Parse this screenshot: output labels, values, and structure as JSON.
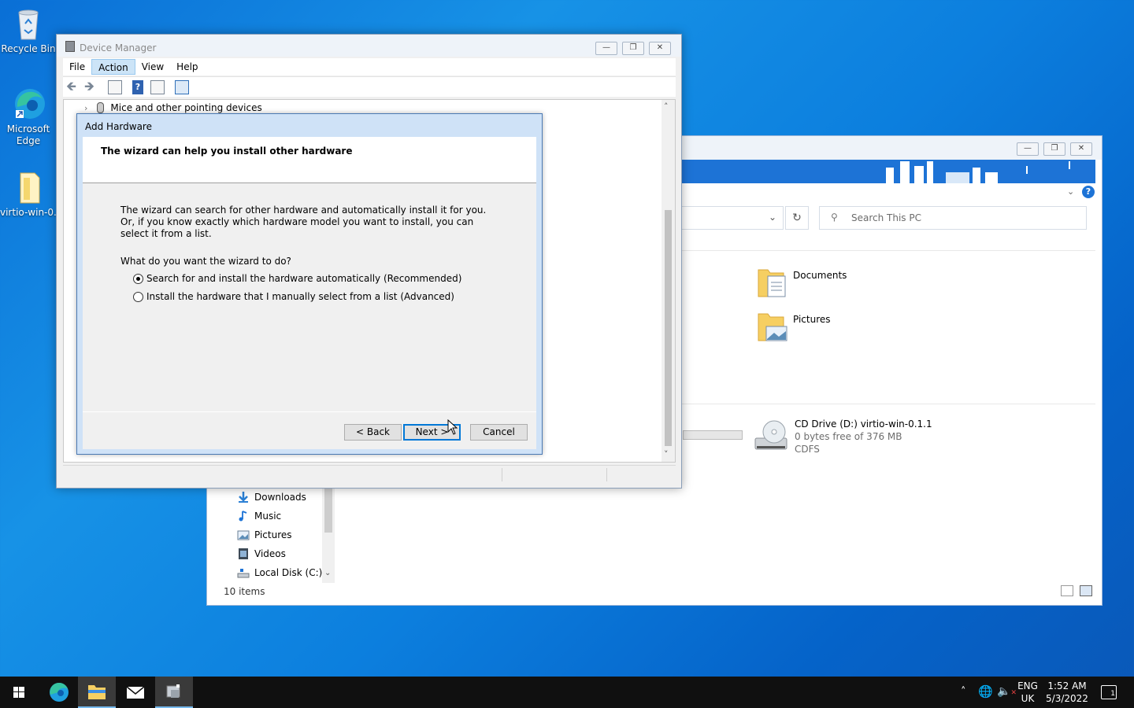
{
  "desktop": {
    "icons": [
      {
        "label": "Recycle Bin"
      },
      {
        "label": "Microsoft Edge"
      },
      {
        "label": "virtio-win-0..."
      }
    ]
  },
  "explorer": {
    "search_placeholder": "Search This PC",
    "folders": [
      {
        "name": "Documents"
      },
      {
        "name": "Pictures"
      }
    ],
    "drive": {
      "name": "CD Drive (D:) virtio-win-0.1.1",
      "free": "0 bytes free of 376 MB",
      "fs": "CDFS"
    },
    "nav": [
      {
        "label": "Downloads"
      },
      {
        "label": "Music"
      },
      {
        "label": "Pictures"
      },
      {
        "label": "Videos"
      },
      {
        "label": "Local Disk (C:)"
      }
    ],
    "status": "10 items"
  },
  "device_manager": {
    "title": "Device Manager",
    "menu": [
      {
        "label": "File"
      },
      {
        "label": "Action"
      },
      {
        "label": "View"
      },
      {
        "label": "Help"
      }
    ],
    "tree_item": "Mice and other pointing devices"
  },
  "wizard": {
    "title": "Add Hardware",
    "header": "The wizard can help you install other hardware",
    "description": "The wizard can search for other hardware and automatically install it for you. Or, if you know exactly which hardware model you want to install, you can select it from a list.",
    "question": "What do you want the wizard to do?",
    "options": [
      {
        "label": "Search for and install the hardware automatically (Recommended)",
        "selected": true
      },
      {
        "label": "Install the hardware that I manually select from a list (Advanced)",
        "selected": false
      }
    ],
    "buttons": {
      "back": "< Back",
      "next": "Next >",
      "cancel": "Cancel"
    }
  },
  "taskbar": {
    "lang_top": "ENG",
    "lang_bottom": "UK",
    "time": "1:52 AM",
    "date": "5/3/2022",
    "notification_count": "1"
  }
}
